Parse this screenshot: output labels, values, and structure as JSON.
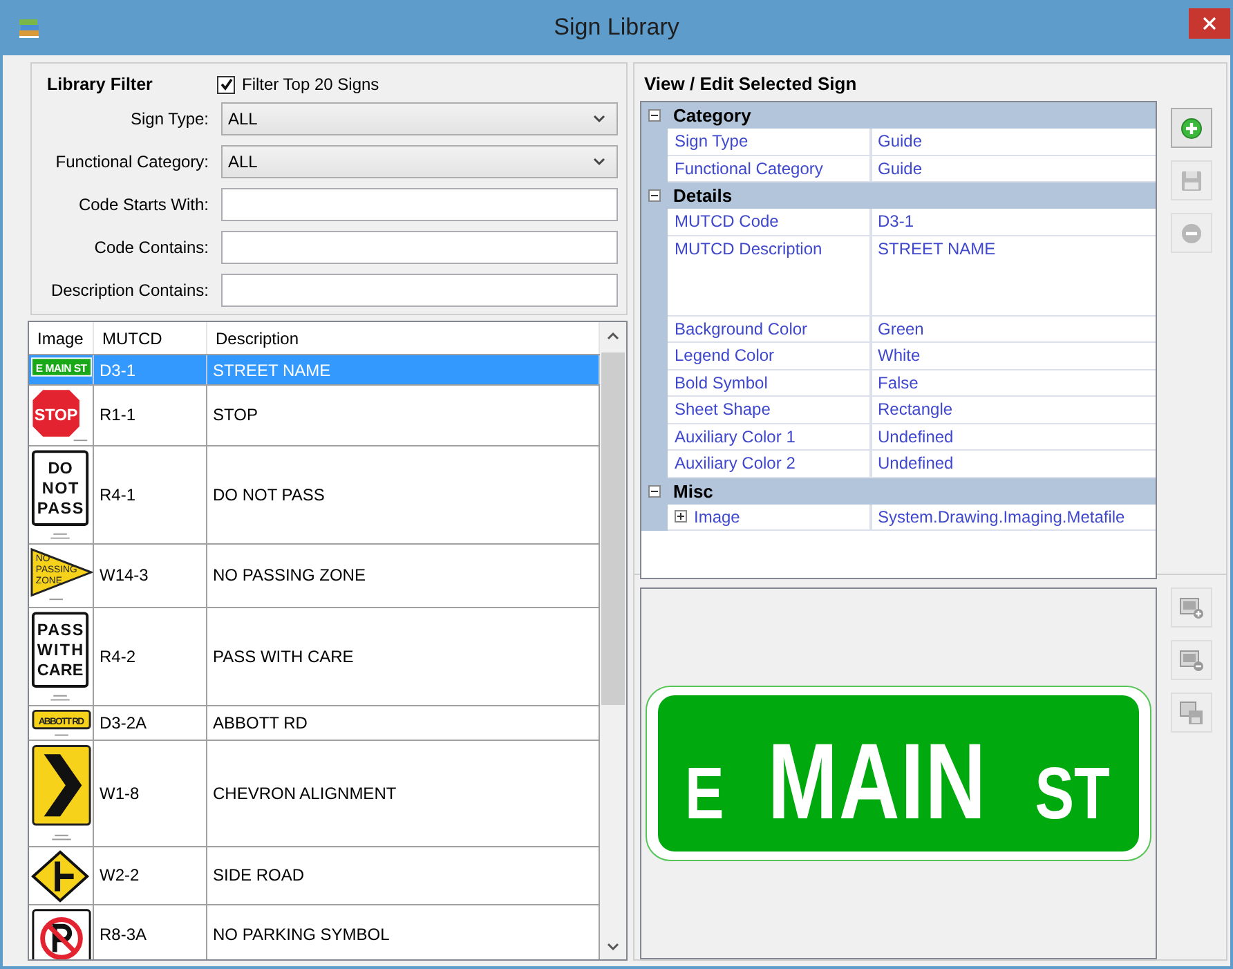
{
  "window": {
    "title": "Sign Library"
  },
  "library_filter": {
    "title": "Library Filter",
    "top20": {
      "label": "Filter Top 20 Signs",
      "checked": true
    },
    "fields": [
      {
        "kind": "dropdown",
        "label": "Sign Type:",
        "value": "ALL"
      },
      {
        "kind": "dropdown",
        "label": "Functional Category:",
        "value": "ALL"
      },
      {
        "kind": "text",
        "label": "Code Starts With:"
      },
      {
        "kind": "text",
        "label": "Code Contains:"
      },
      {
        "kind": "text",
        "label": "Description Contains:"
      }
    ]
  },
  "sign_table": {
    "columns": [
      "Image",
      "MUTCD",
      "Description"
    ],
    "rows": [
      {
        "kind": "street_name",
        "image_legend": [
          "E MAIN ST"
        ],
        "mutcd": "D3-1",
        "description": "STREET NAME",
        "selected": true
      },
      {
        "kind": "octagon",
        "image_legend": [
          "STOP"
        ],
        "mutcd": "R1-1",
        "description": "STOP",
        "selected": false
      },
      {
        "kind": "regulatory",
        "image_legend": [
          "DO",
          "NOT",
          "PASS"
        ],
        "mutcd": "R4-1",
        "description": "DO NOT PASS",
        "selected": false
      },
      {
        "kind": "pennant",
        "image_legend": [
          "NO",
          "PASSING",
          "ZONE"
        ],
        "mutcd": "W14-3",
        "description": "NO PASSING ZONE",
        "selected": false
      },
      {
        "kind": "regulatory",
        "image_legend": [
          "PASS",
          "WITH",
          "CARE"
        ],
        "mutcd": "R4-2",
        "description": "PASS WITH CARE",
        "selected": false
      },
      {
        "kind": "yellow_name",
        "image_legend": [
          "ABBOTT RD"
        ],
        "mutcd": "D3-2A",
        "description": "ABBOTT RD",
        "selected": false
      },
      {
        "kind": "chevron",
        "image_legend": [],
        "mutcd": "W1-8",
        "description": "CHEVRON ALIGNMENT",
        "selected": false
      },
      {
        "kind": "side_road",
        "image_legend": [],
        "mutcd": "W2-2",
        "description": "SIDE ROAD",
        "selected": false
      },
      {
        "kind": "no_parking",
        "image_legend": [],
        "mutcd": "R8-3A",
        "description": "NO PARKING SYMBOL",
        "selected": false
      }
    ]
  },
  "selected_sign": {
    "title": "View / Edit Selected Sign",
    "categories": [
      {
        "name": "Category",
        "expanded": true,
        "properties": [
          {
            "kind": "text",
            "name": "Sign Type",
            "value": "Guide"
          },
          {
            "kind": "text",
            "name": "Functional Category",
            "value": "Guide"
          }
        ]
      },
      {
        "name": "Details",
        "expanded": true,
        "properties": [
          {
            "kind": "text",
            "name": "MUTCD Code",
            "value": "D3-1"
          },
          {
            "kind": "multiline",
            "name": "MUTCD Description",
            "value": "STREET NAME"
          },
          {
            "kind": "text",
            "name": "Background Color",
            "value": "Green"
          },
          {
            "kind": "text",
            "name": "Legend Color",
            "value": "White"
          },
          {
            "kind": "text",
            "name": "Bold Symbol",
            "value": "False"
          },
          {
            "kind": "text",
            "name": "Sheet Shape",
            "value": "Rectangle"
          },
          {
            "kind": "text",
            "name": "Auxiliary Color 1",
            "value": "Undefined"
          },
          {
            "kind": "text",
            "name": "Auxiliary Color 2",
            "value": "Undefined"
          }
        ]
      },
      {
        "name": "Misc",
        "expanded": true,
        "properties": [
          {
            "kind": "expandable",
            "expanded": false,
            "name": "Image",
            "value": "System.Drawing.Imaging.Metafile"
          }
        ]
      }
    ],
    "sign_buttons": [
      {
        "kind": "add",
        "disabled": false
      },
      {
        "kind": "save",
        "disabled": true
      },
      {
        "kind": "remove",
        "disabled": true
      }
    ],
    "image_buttons": [
      {
        "kind": "add_image",
        "disabled": true
      },
      {
        "kind": "remove_image",
        "disabled": true
      },
      {
        "kind": "save_image",
        "disabled": true
      }
    ],
    "preview": {
      "legend": [
        {
          "text": "E",
          "kind": "prefix"
        },
        {
          "text": "MAIN",
          "kind": "name"
        },
        {
          "text": "ST",
          "kind": "suffix"
        }
      ]
    }
  }
}
